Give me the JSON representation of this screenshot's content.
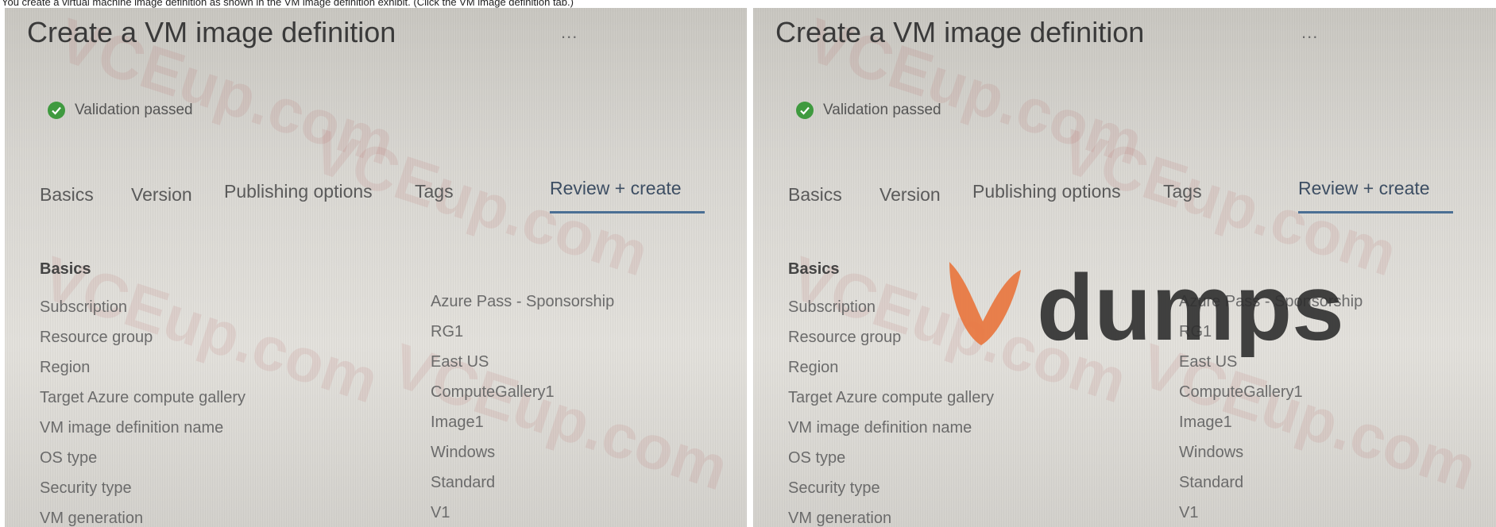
{
  "caption": "You create a virtual machine image definition as shown in the VM image definition exhibit. (Click the VM image definition tab.)",
  "page": {
    "title": "Create a VM image definition",
    "more_label": "...",
    "validation_text": "Validation passed"
  },
  "tabs": [
    {
      "label": "Basics"
    },
    {
      "label": "Version"
    },
    {
      "label": "Publishing options"
    },
    {
      "label": "Tags"
    },
    {
      "label": "Review + create",
      "active": true
    }
  ],
  "section": {
    "heading": "Basics",
    "rows": [
      {
        "label": "Subscription",
        "value": "Azure Pass - Sponsorship"
      },
      {
        "label": "Resource group",
        "value": "RG1"
      },
      {
        "label": "Region",
        "value": "East US"
      },
      {
        "label": "Target Azure compute gallery",
        "value": "ComputeGallery1"
      },
      {
        "label": "VM image definition name",
        "value": "Image1"
      },
      {
        "label": "OS type",
        "value": "Windows"
      },
      {
        "label": "Security type",
        "value": "Standard"
      },
      {
        "label": "VM generation",
        "value": "V1"
      }
    ]
  },
  "watermark_text": "VCEup.com",
  "logo": {
    "text": "dumps",
    "color": "#e8763f"
  },
  "colors": {
    "check": "#3f9a3f",
    "tab_underline": "#4b6f94"
  }
}
